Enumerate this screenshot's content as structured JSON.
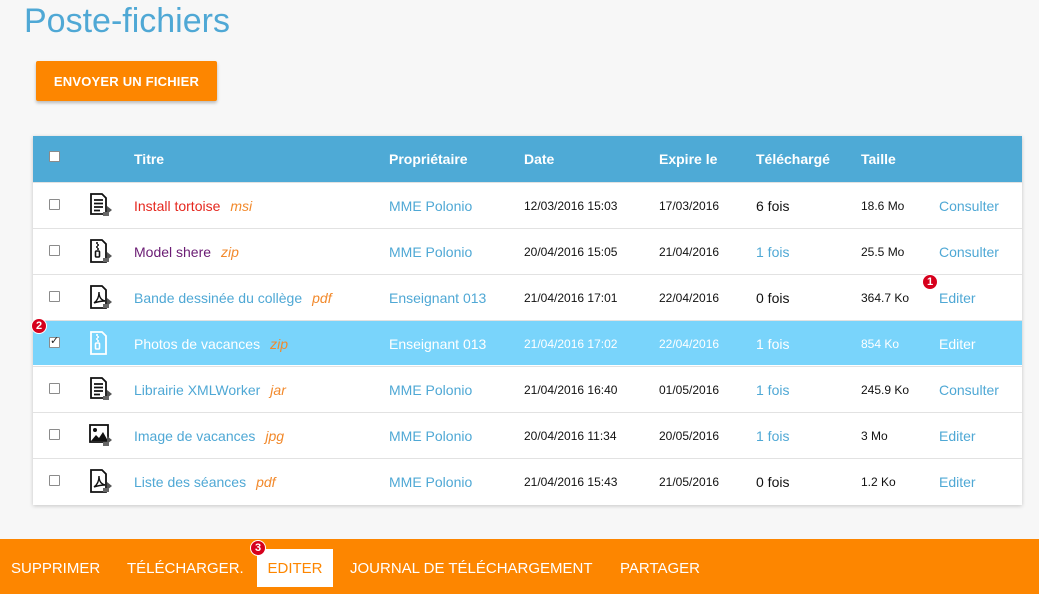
{
  "page": {
    "title": "Poste-fichiers"
  },
  "upload_button": "ENVOYER UN FICHIER",
  "table": {
    "columns": {
      "title": "Titre",
      "owner": "Propriétaire",
      "date": "Date",
      "expires": "Expire le",
      "downloaded": "Téléchargé",
      "size": "Taille"
    },
    "rows": [
      {
        "icon": "document-icon",
        "name": "Install tortoise",
        "type": "msi",
        "owner": "MME Polonio",
        "date": "12/03/2016 15:03",
        "expires": "17/03/2016",
        "downloads": "6 fois",
        "size": "18.6 Mo",
        "action": "Consulter",
        "checked": false
      },
      {
        "icon": "zip-icon",
        "name": "Model shere",
        "type": "zip",
        "owner": "MME Polonio",
        "date": "20/04/2016 15:05",
        "expires": "21/04/2016",
        "downloads": "1 fois",
        "size": "25.5 Mo",
        "action": "Consulter",
        "checked": false
      },
      {
        "icon": "pdf-icon",
        "name": "Bande dessinée du collège",
        "type": "pdf",
        "owner": "Enseignant 013",
        "date": "21/04/2016 17:01",
        "expires": "22/04/2016",
        "downloads": "0 fois",
        "size": "364.7 Ko",
        "action": "Editer",
        "checked": false
      },
      {
        "icon": "zip-icon",
        "name": "Photos de vacances",
        "type": "zip",
        "owner": "Enseignant 013",
        "date": "21/04/2016 17:02",
        "expires": "22/04/2016",
        "downloads": "1 fois",
        "size": "854 Ko",
        "action": "Editer",
        "checked": true
      },
      {
        "icon": "document-icon",
        "name": "Librairie XMLWorker",
        "type": "jar",
        "owner": "MME Polonio",
        "date": "21/04/2016 16:40",
        "expires": "01/05/2016",
        "downloads": "1 fois",
        "size": "245.9 Ko",
        "action": "Consulter",
        "checked": false
      },
      {
        "icon": "image-icon",
        "name": "Image de vacances",
        "type": "jpg",
        "owner": "MME Polonio",
        "date": "20/04/2016 11:34",
        "expires": "20/05/2016",
        "downloads": "1 fois",
        "size": "3 Mo",
        "action": "Editer",
        "checked": false
      },
      {
        "icon": "pdf-icon",
        "name": "Liste des séances",
        "type": "pdf",
        "owner": "MME Polonio",
        "date": "21/04/2016 15:43",
        "expires": "21/05/2016",
        "downloads": "0 fois",
        "size": "1.2 Ko",
        "action": "Editer",
        "checked": false
      }
    ]
  },
  "badges": {
    "one": "1",
    "two": "2",
    "three": "3"
  },
  "bottom_bar": {
    "delete": "SUPPRIMER",
    "download": "TÉLÉCHARGER.",
    "edit": "EDITER",
    "log": "JOURNAL DE TÉLÉCHARGEMENT",
    "share": "PARTAGER"
  },
  "colors": {
    "accent": "#fd8600",
    "header": "#4eaad6",
    "link": "#4fa8d5",
    "selected_row": "#79d4fb",
    "badge": "#d6001c"
  }
}
